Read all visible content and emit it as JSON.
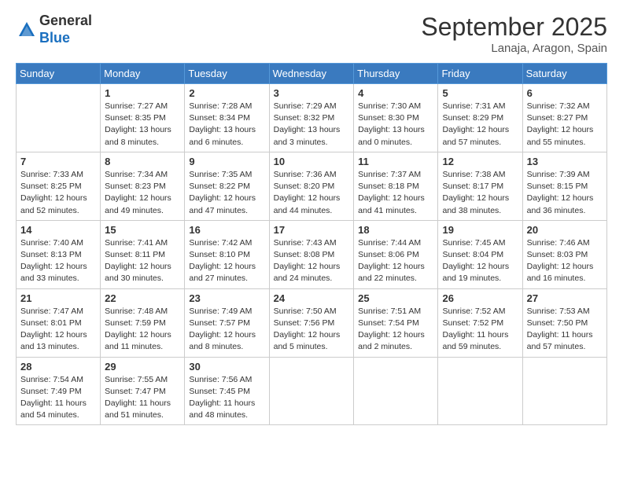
{
  "header": {
    "logo_line1": "General",
    "logo_line2": "Blue",
    "month": "September 2025",
    "location": "Lanaja, Aragon, Spain"
  },
  "weekdays": [
    "Sunday",
    "Monday",
    "Tuesday",
    "Wednesday",
    "Thursday",
    "Friday",
    "Saturday"
  ],
  "weeks": [
    [
      {
        "day": "",
        "info": ""
      },
      {
        "day": "1",
        "info": "Sunrise: 7:27 AM\nSunset: 8:35 PM\nDaylight: 13 hours\nand 8 minutes."
      },
      {
        "day": "2",
        "info": "Sunrise: 7:28 AM\nSunset: 8:34 PM\nDaylight: 13 hours\nand 6 minutes."
      },
      {
        "day": "3",
        "info": "Sunrise: 7:29 AM\nSunset: 8:32 PM\nDaylight: 13 hours\nand 3 minutes."
      },
      {
        "day": "4",
        "info": "Sunrise: 7:30 AM\nSunset: 8:30 PM\nDaylight: 13 hours\nand 0 minutes."
      },
      {
        "day": "5",
        "info": "Sunrise: 7:31 AM\nSunset: 8:29 PM\nDaylight: 12 hours\nand 57 minutes."
      },
      {
        "day": "6",
        "info": "Sunrise: 7:32 AM\nSunset: 8:27 PM\nDaylight: 12 hours\nand 55 minutes."
      }
    ],
    [
      {
        "day": "7",
        "info": "Sunrise: 7:33 AM\nSunset: 8:25 PM\nDaylight: 12 hours\nand 52 minutes."
      },
      {
        "day": "8",
        "info": "Sunrise: 7:34 AM\nSunset: 8:23 PM\nDaylight: 12 hours\nand 49 minutes."
      },
      {
        "day": "9",
        "info": "Sunrise: 7:35 AM\nSunset: 8:22 PM\nDaylight: 12 hours\nand 47 minutes."
      },
      {
        "day": "10",
        "info": "Sunrise: 7:36 AM\nSunset: 8:20 PM\nDaylight: 12 hours\nand 44 minutes."
      },
      {
        "day": "11",
        "info": "Sunrise: 7:37 AM\nSunset: 8:18 PM\nDaylight: 12 hours\nand 41 minutes."
      },
      {
        "day": "12",
        "info": "Sunrise: 7:38 AM\nSunset: 8:17 PM\nDaylight: 12 hours\nand 38 minutes."
      },
      {
        "day": "13",
        "info": "Sunrise: 7:39 AM\nSunset: 8:15 PM\nDaylight: 12 hours\nand 36 minutes."
      }
    ],
    [
      {
        "day": "14",
        "info": "Sunrise: 7:40 AM\nSunset: 8:13 PM\nDaylight: 12 hours\nand 33 minutes."
      },
      {
        "day": "15",
        "info": "Sunrise: 7:41 AM\nSunset: 8:11 PM\nDaylight: 12 hours\nand 30 minutes."
      },
      {
        "day": "16",
        "info": "Sunrise: 7:42 AM\nSunset: 8:10 PM\nDaylight: 12 hours\nand 27 minutes."
      },
      {
        "day": "17",
        "info": "Sunrise: 7:43 AM\nSunset: 8:08 PM\nDaylight: 12 hours\nand 24 minutes."
      },
      {
        "day": "18",
        "info": "Sunrise: 7:44 AM\nSunset: 8:06 PM\nDaylight: 12 hours\nand 22 minutes."
      },
      {
        "day": "19",
        "info": "Sunrise: 7:45 AM\nSunset: 8:04 PM\nDaylight: 12 hours\nand 19 minutes."
      },
      {
        "day": "20",
        "info": "Sunrise: 7:46 AM\nSunset: 8:03 PM\nDaylight: 12 hours\nand 16 minutes."
      }
    ],
    [
      {
        "day": "21",
        "info": "Sunrise: 7:47 AM\nSunset: 8:01 PM\nDaylight: 12 hours\nand 13 minutes."
      },
      {
        "day": "22",
        "info": "Sunrise: 7:48 AM\nSunset: 7:59 PM\nDaylight: 12 hours\nand 11 minutes."
      },
      {
        "day": "23",
        "info": "Sunrise: 7:49 AM\nSunset: 7:57 PM\nDaylight: 12 hours\nand 8 minutes."
      },
      {
        "day": "24",
        "info": "Sunrise: 7:50 AM\nSunset: 7:56 PM\nDaylight: 12 hours\nand 5 minutes."
      },
      {
        "day": "25",
        "info": "Sunrise: 7:51 AM\nSunset: 7:54 PM\nDaylight: 12 hours\nand 2 minutes."
      },
      {
        "day": "26",
        "info": "Sunrise: 7:52 AM\nSunset: 7:52 PM\nDaylight: 11 hours\nand 59 minutes."
      },
      {
        "day": "27",
        "info": "Sunrise: 7:53 AM\nSunset: 7:50 PM\nDaylight: 11 hours\nand 57 minutes."
      }
    ],
    [
      {
        "day": "28",
        "info": "Sunrise: 7:54 AM\nSunset: 7:49 PM\nDaylight: 11 hours\nand 54 minutes."
      },
      {
        "day": "29",
        "info": "Sunrise: 7:55 AM\nSunset: 7:47 PM\nDaylight: 11 hours\nand 51 minutes."
      },
      {
        "day": "30",
        "info": "Sunrise: 7:56 AM\nSunset: 7:45 PM\nDaylight: 11 hours\nand 48 minutes."
      },
      {
        "day": "",
        "info": ""
      },
      {
        "day": "",
        "info": ""
      },
      {
        "day": "",
        "info": ""
      },
      {
        "day": "",
        "info": ""
      }
    ]
  ]
}
